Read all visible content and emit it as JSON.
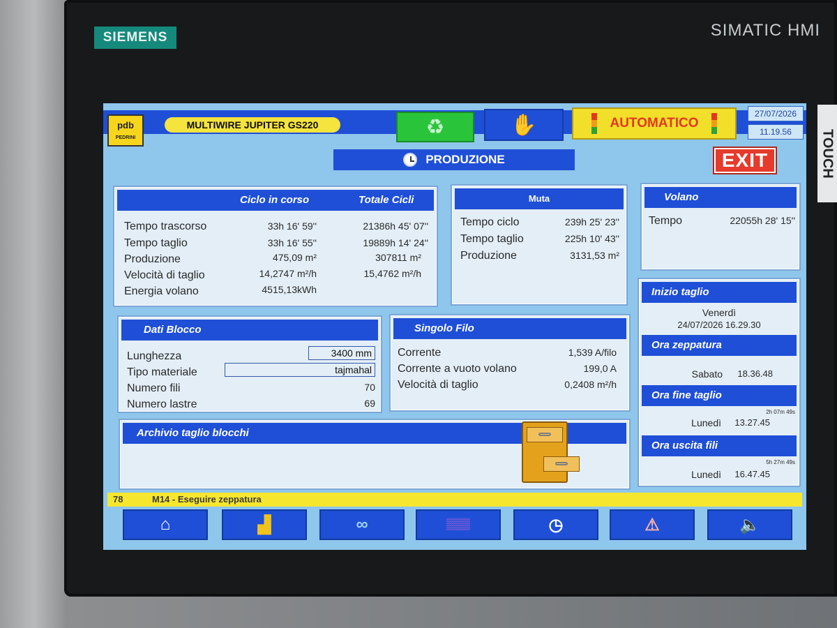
{
  "device": {
    "brand": "SIEMENS",
    "model": "SIMATIC HMI",
    "touch_label": "TOUCH"
  },
  "header": {
    "logo_text": "pdb",
    "logo_sub": "PEDRINI",
    "machine_name": "MULTIWIRE JUPITER GS220",
    "mode_label": "AUTOMATICO",
    "date": "27/07/2026",
    "time": "11.19.56",
    "section_title": "PRODUZIONE",
    "exit_label": "EXIT"
  },
  "ciclo": {
    "col_current": "Ciclo in corso",
    "col_total": "Totale Cicli",
    "rows": [
      {
        "label": "Tempo trascorso",
        "current": "33h 16' 59''",
        "total": "21386h 45' 07''"
      },
      {
        "label": "Tempo taglio",
        "current": "33h 16' 55''",
        "total": "19889h 14' 24''"
      },
      {
        "label": "Produzione",
        "current": "475,09 m²",
        "total": "307811 m²"
      },
      {
        "label": "Velocità di taglio",
        "current": "14,2747 m²/h",
        "total": "15,4762 m²/h"
      },
      {
        "label": "Energia volano",
        "current": "4515,13kWh",
        "total": ""
      }
    ]
  },
  "muta": {
    "title": "Muta",
    "rows": [
      {
        "label": "Tempo ciclo",
        "value": "239h 25' 23''"
      },
      {
        "label": "Tempo taglio",
        "value": "225h 10' 43''"
      },
      {
        "label": "Produzione",
        "value": "3131,53 m²"
      }
    ]
  },
  "volano": {
    "title": "Volano",
    "label": "Tempo",
    "value": "22055h 28' 15''"
  },
  "dati_blocco": {
    "title": "Dati Blocco",
    "lunghezza_label": "Lunghezza",
    "lunghezza_value": "3400 mm",
    "materiale_label": "Tipo materiale",
    "materiale_value": "tajmahal",
    "fili_label": "Numero fili",
    "fili_value": "70",
    "lastre_label": "Numero lastre",
    "lastre_value": "69"
  },
  "singolo_filo": {
    "title": "Singolo Filo",
    "rows": [
      {
        "label": "Corrente",
        "value": "1,539 A/filo"
      },
      {
        "label": "Corrente a vuoto volano",
        "value": "199,0 A"
      },
      {
        "label": "Velocità di taglio",
        "value": "0,2408 m²/h"
      }
    ]
  },
  "archivio": {
    "title": "Archivio taglio blocchi"
  },
  "schedule": {
    "inizio_title": "Inizio taglio",
    "inizio_day": "Venerdì",
    "inizio_datetime": "24/07/2026 16.29.30",
    "zeppatura_title": "Ora zeppatura",
    "zeppatura_day": "Sabato",
    "zeppatura_time": "18.36.48",
    "fine_title": "Ora fine taglio",
    "fine_remaining": "2h 07m 49s",
    "fine_day": "Lunedì",
    "fine_time": "13.27.45",
    "uscita_title": "Ora uscita fili",
    "uscita_remaining": "5h 27m 49s",
    "uscita_day": "Lunedì",
    "uscita_time": "16.47.45"
  },
  "status": {
    "code": "78",
    "message": "M14 - Eseguire zeppatura"
  },
  "nav": [
    {
      "icon": "home-icon",
      "glyph": "⌂"
    },
    {
      "icon": "forklift-icon",
      "glyph": "▟"
    },
    {
      "icon": "wire-diagram-icon",
      "glyph": "∞"
    },
    {
      "icon": "grid-pattern-icon",
      "glyph": "▒▒▒"
    },
    {
      "icon": "clock-icon",
      "glyph": "◷"
    },
    {
      "icon": "alarm-icon",
      "glyph": "⚠"
    },
    {
      "icon": "speaker-icon",
      "glyph": "🔈"
    }
  ],
  "colors": {
    "header_blue": "#1f4fd6",
    "screen_bg": "#8fc6ec",
    "status_yellow": "#f6e62e",
    "auto_text_red": "#e2381f",
    "run_green": "#29c43a",
    "exit_red": "#e53a2c"
  }
}
